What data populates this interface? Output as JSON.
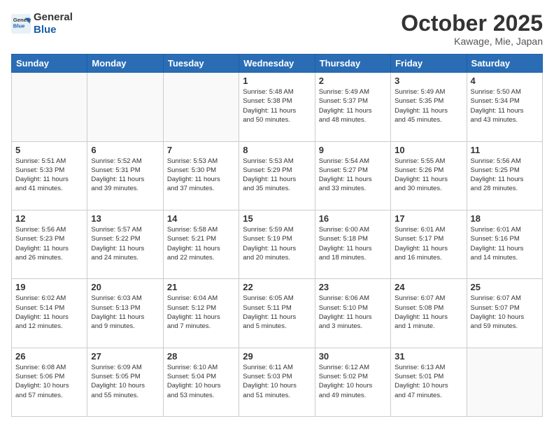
{
  "header": {
    "logo_line1": "General",
    "logo_line2": "Blue",
    "month": "October 2025",
    "location": "Kawage, Mie, Japan"
  },
  "weekdays": [
    "Sunday",
    "Monday",
    "Tuesday",
    "Wednesday",
    "Thursday",
    "Friday",
    "Saturday"
  ],
  "weeks": [
    [
      {
        "day": "",
        "info": ""
      },
      {
        "day": "",
        "info": ""
      },
      {
        "day": "",
        "info": ""
      },
      {
        "day": "1",
        "info": "Sunrise: 5:48 AM\nSunset: 5:38 PM\nDaylight: 11 hours\nand 50 minutes."
      },
      {
        "day": "2",
        "info": "Sunrise: 5:49 AM\nSunset: 5:37 PM\nDaylight: 11 hours\nand 48 minutes."
      },
      {
        "day": "3",
        "info": "Sunrise: 5:49 AM\nSunset: 5:35 PM\nDaylight: 11 hours\nand 45 minutes."
      },
      {
        "day": "4",
        "info": "Sunrise: 5:50 AM\nSunset: 5:34 PM\nDaylight: 11 hours\nand 43 minutes."
      }
    ],
    [
      {
        "day": "5",
        "info": "Sunrise: 5:51 AM\nSunset: 5:33 PM\nDaylight: 11 hours\nand 41 minutes."
      },
      {
        "day": "6",
        "info": "Sunrise: 5:52 AM\nSunset: 5:31 PM\nDaylight: 11 hours\nand 39 minutes."
      },
      {
        "day": "7",
        "info": "Sunrise: 5:53 AM\nSunset: 5:30 PM\nDaylight: 11 hours\nand 37 minutes."
      },
      {
        "day": "8",
        "info": "Sunrise: 5:53 AM\nSunset: 5:29 PM\nDaylight: 11 hours\nand 35 minutes."
      },
      {
        "day": "9",
        "info": "Sunrise: 5:54 AM\nSunset: 5:27 PM\nDaylight: 11 hours\nand 33 minutes."
      },
      {
        "day": "10",
        "info": "Sunrise: 5:55 AM\nSunset: 5:26 PM\nDaylight: 11 hours\nand 30 minutes."
      },
      {
        "day": "11",
        "info": "Sunrise: 5:56 AM\nSunset: 5:25 PM\nDaylight: 11 hours\nand 28 minutes."
      }
    ],
    [
      {
        "day": "12",
        "info": "Sunrise: 5:56 AM\nSunset: 5:23 PM\nDaylight: 11 hours\nand 26 minutes."
      },
      {
        "day": "13",
        "info": "Sunrise: 5:57 AM\nSunset: 5:22 PM\nDaylight: 11 hours\nand 24 minutes."
      },
      {
        "day": "14",
        "info": "Sunrise: 5:58 AM\nSunset: 5:21 PM\nDaylight: 11 hours\nand 22 minutes."
      },
      {
        "day": "15",
        "info": "Sunrise: 5:59 AM\nSunset: 5:19 PM\nDaylight: 11 hours\nand 20 minutes."
      },
      {
        "day": "16",
        "info": "Sunrise: 6:00 AM\nSunset: 5:18 PM\nDaylight: 11 hours\nand 18 minutes."
      },
      {
        "day": "17",
        "info": "Sunrise: 6:01 AM\nSunset: 5:17 PM\nDaylight: 11 hours\nand 16 minutes."
      },
      {
        "day": "18",
        "info": "Sunrise: 6:01 AM\nSunset: 5:16 PM\nDaylight: 11 hours\nand 14 minutes."
      }
    ],
    [
      {
        "day": "19",
        "info": "Sunrise: 6:02 AM\nSunset: 5:14 PM\nDaylight: 11 hours\nand 12 minutes."
      },
      {
        "day": "20",
        "info": "Sunrise: 6:03 AM\nSunset: 5:13 PM\nDaylight: 11 hours\nand 9 minutes."
      },
      {
        "day": "21",
        "info": "Sunrise: 6:04 AM\nSunset: 5:12 PM\nDaylight: 11 hours\nand 7 minutes."
      },
      {
        "day": "22",
        "info": "Sunrise: 6:05 AM\nSunset: 5:11 PM\nDaylight: 11 hours\nand 5 minutes."
      },
      {
        "day": "23",
        "info": "Sunrise: 6:06 AM\nSunset: 5:10 PM\nDaylight: 11 hours\nand 3 minutes."
      },
      {
        "day": "24",
        "info": "Sunrise: 6:07 AM\nSunset: 5:08 PM\nDaylight: 11 hours\nand 1 minute."
      },
      {
        "day": "25",
        "info": "Sunrise: 6:07 AM\nSunset: 5:07 PM\nDaylight: 10 hours\nand 59 minutes."
      }
    ],
    [
      {
        "day": "26",
        "info": "Sunrise: 6:08 AM\nSunset: 5:06 PM\nDaylight: 10 hours\nand 57 minutes."
      },
      {
        "day": "27",
        "info": "Sunrise: 6:09 AM\nSunset: 5:05 PM\nDaylight: 10 hours\nand 55 minutes."
      },
      {
        "day": "28",
        "info": "Sunrise: 6:10 AM\nSunset: 5:04 PM\nDaylight: 10 hours\nand 53 minutes."
      },
      {
        "day": "29",
        "info": "Sunrise: 6:11 AM\nSunset: 5:03 PM\nDaylight: 10 hours\nand 51 minutes."
      },
      {
        "day": "30",
        "info": "Sunrise: 6:12 AM\nSunset: 5:02 PM\nDaylight: 10 hours\nand 49 minutes."
      },
      {
        "day": "31",
        "info": "Sunrise: 6:13 AM\nSunset: 5:01 PM\nDaylight: 10 hours\nand 47 minutes."
      },
      {
        "day": "",
        "info": ""
      }
    ]
  ]
}
